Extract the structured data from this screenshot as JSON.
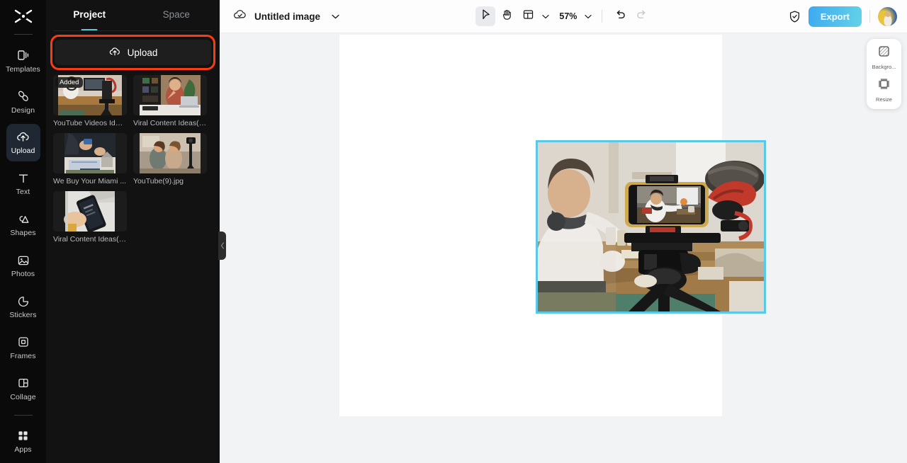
{
  "rail": {
    "logo_icon": "capcut-logo-icon",
    "items": [
      {
        "label": "Templates",
        "icon": "templates-icon",
        "active": false
      },
      {
        "label": "Design",
        "icon": "design-icon",
        "active": false
      },
      {
        "label": "Upload",
        "icon": "upload-cloud-icon",
        "active": true
      },
      {
        "label": "Text",
        "icon": "text-icon",
        "active": false
      },
      {
        "label": "Shapes",
        "icon": "shapes-icon",
        "active": false
      },
      {
        "label": "Photos",
        "icon": "photos-icon",
        "active": false
      },
      {
        "label": "Stickers",
        "icon": "stickers-icon",
        "active": false
      },
      {
        "label": "Frames",
        "icon": "frames-icon",
        "active": false
      },
      {
        "label": "Collage",
        "icon": "collage-icon",
        "active": false
      },
      {
        "label": "Apps",
        "icon": "apps-grid-icon",
        "active": false
      }
    ]
  },
  "panel": {
    "tabs": [
      {
        "label": "Project",
        "active": true
      },
      {
        "label": "Space",
        "active": false
      }
    ],
    "upload": {
      "label": "Upload",
      "icon": "upload-cloud-icon",
      "highlighted": true
    },
    "thumbnails": [
      {
        "caption": "YouTube Videos Idea...",
        "badge": "Added"
      },
      {
        "caption": "Viral Content Ideas(7...",
        "badge": ""
      },
      {
        "caption": "We Buy Your Miami ...",
        "badge": ""
      },
      {
        "caption": "YouTube(9).jpg",
        "badge": ""
      },
      {
        "caption": "Viral Content Ideas(3...",
        "badge": ""
      }
    ],
    "collapse_icon": "chevron-left-icon"
  },
  "topbar": {
    "cloud_icon": "cloud-saved-icon",
    "title": "Untitled image",
    "title_caret_icon": "chevron-down-icon",
    "tools": [
      {
        "name": "select-tool",
        "icon": "cursor-arrow-icon",
        "selected": true
      },
      {
        "name": "hand-tool",
        "icon": "hand-icon",
        "selected": false
      },
      {
        "name": "layout-tool",
        "icon": "layout-panel-icon",
        "selected": false
      }
    ],
    "layout_caret_icon": "chevron-down-icon",
    "zoom_level": "57%",
    "zoom_caret_icon": "chevron-down-icon",
    "undo_icon": "undo-arrow-icon",
    "redo_icon": "redo-arrow-icon",
    "shield_icon": "shield-check-icon",
    "export_label": "Export",
    "avatar_name": "user-avatar"
  },
  "right_panel": {
    "items": [
      {
        "label": "Backgro...",
        "icon": "background-hatch-icon"
      },
      {
        "label": "Resize",
        "icon": "resize-icon"
      }
    ]
  },
  "colors": {
    "rail_bg": "#0a0a0a",
    "panel_bg": "#121212",
    "accent_tab": "#56c8e0",
    "highlight_box": "#fa3c11",
    "selection_border": "#5cc8e8",
    "export_gradient_from": "#3ea9f0",
    "export_gradient_to": "#62d3e8",
    "stage_bg": "#f2f3f5"
  }
}
